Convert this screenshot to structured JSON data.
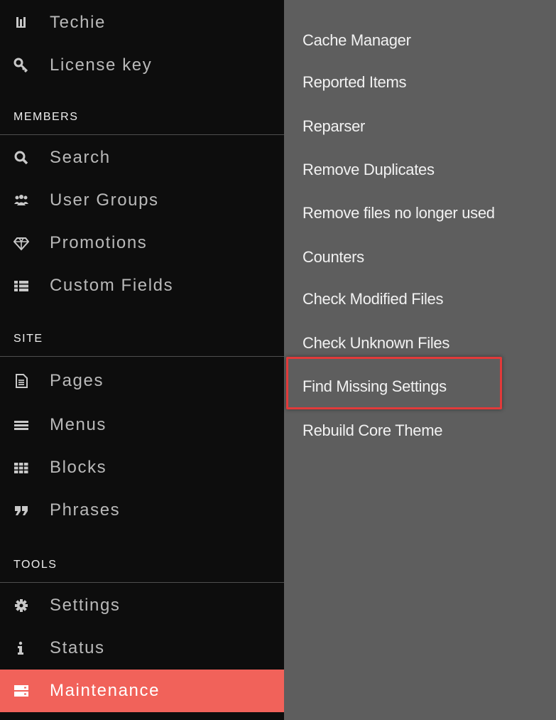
{
  "sidebar": {
    "top_items": [
      {
        "label": "Techie",
        "icon": "techie-logo-icon"
      },
      {
        "label": "License key",
        "icon": "key-icon"
      }
    ],
    "sections": [
      {
        "title": "MEMBERS",
        "items": [
          {
            "label": "Search",
            "icon": "search-icon"
          },
          {
            "label": "User Groups",
            "icon": "users-icon"
          },
          {
            "label": "Promotions",
            "icon": "diamond-icon"
          },
          {
            "label": "Custom Fields",
            "icon": "list-icon"
          }
        ]
      },
      {
        "title": "SITE",
        "items": [
          {
            "label": "Pages",
            "icon": "page-icon"
          },
          {
            "label": "Menus",
            "icon": "menu-icon"
          },
          {
            "label": "Blocks",
            "icon": "grid-icon"
          },
          {
            "label": "Phrases",
            "icon": "quote-icon"
          }
        ]
      },
      {
        "title": "TOOLS",
        "items": [
          {
            "label": "Settings",
            "icon": "gear-icon"
          },
          {
            "label": "Status",
            "icon": "info-icon"
          },
          {
            "label": "Maintenance",
            "icon": "server-icon",
            "active": true
          }
        ]
      }
    ]
  },
  "submenu": {
    "items": [
      {
        "label": "Cache Manager"
      },
      {
        "label": "Reported Items"
      },
      {
        "label": "Reparser"
      },
      {
        "label": "Remove Duplicates"
      },
      {
        "label": "Remove files no longer used"
      },
      {
        "label": "Counters"
      },
      {
        "label": "Check Modified Files"
      },
      {
        "label": "Check Unknown Files"
      },
      {
        "label": "Find Missing Settings",
        "highlighted": true
      },
      {
        "label": "Rebuild Core Theme"
      }
    ]
  },
  "colors": {
    "sidebar_bg": "#0d0d0d",
    "submenu_bg": "#5e5e5e",
    "active_bg": "#f1625a",
    "highlight_border": "#e23a3a"
  }
}
